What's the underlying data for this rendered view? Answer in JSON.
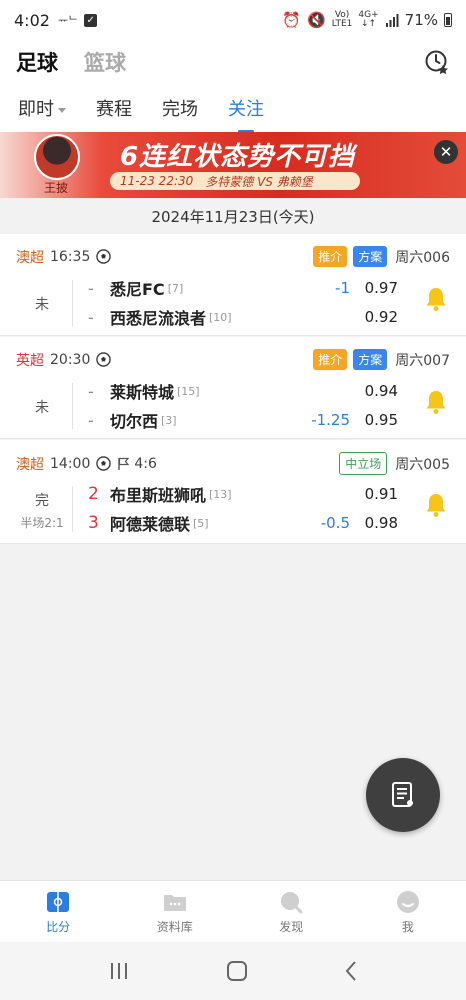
{
  "status_bar": {
    "time": "4:02",
    "left_mini": "ᅲᄂ",
    "net_top": "Vo)",
    "net_bottom": "LTE1",
    "sig_top": "4G+",
    "sig_bottom": "↓↑",
    "battery": "71%"
  },
  "top_nav": {
    "tab_football": "足球",
    "tab_basketball": "篮球"
  },
  "sub_tabs": [
    {
      "label": "即时"
    },
    {
      "label": "赛程"
    },
    {
      "label": "完场"
    },
    {
      "label": "关注"
    }
  ],
  "banner": {
    "person": "王披",
    "headline": "6连红状态势不可挡",
    "date": "11-23 22:30",
    "match": "多特蒙德 VS 弗赖堡"
  },
  "date_header": "2024年11月23日(今天)",
  "matches": [
    {
      "league": "澳超",
      "kickoff": "16:35",
      "badge1": "推介",
      "badge2": "方案",
      "match_no": "周六006",
      "status": "未",
      "home": {
        "score": "-",
        "name": "悉尼FC",
        "rank": "[7]",
        "handicap": "-1",
        "odds": "0.97"
      },
      "away": {
        "score": "-",
        "name": "西悉尼流浪者",
        "rank": "[10]",
        "handicap": "",
        "odds": "0.92"
      }
    },
    {
      "league": "英超",
      "kickoff": "20:30",
      "badge1": "推介",
      "badge2": "方案",
      "match_no": "周六007",
      "status": "未",
      "home": {
        "score": "-",
        "name": "莱斯特城",
        "rank": "[15]",
        "handicap": "",
        "odds": "0.94"
      },
      "away": {
        "score": "-",
        "name": "切尔西",
        "rank": "[3]",
        "handicap": "-1.25",
        "odds": "0.95"
      }
    },
    {
      "league": "澳超",
      "kickoff": "14:00",
      "corners": "4:6",
      "badge1": "中立场",
      "match_no": "周六005",
      "status": "完",
      "halftime": "半场2:1",
      "home": {
        "score": "2",
        "name": "布里斯班狮吼",
        "rank": "[13]",
        "handicap": "",
        "odds": "0.91"
      },
      "away": {
        "score": "3",
        "name": "阿德莱德联",
        "rank": "[5]",
        "handicap": "-0.5",
        "odds": "0.98"
      }
    }
  ],
  "bottom_nav": [
    {
      "label": "比分"
    },
    {
      "label": "资料库"
    },
    {
      "label": "发现"
    },
    {
      "label": "我"
    }
  ],
  "colors": {
    "accent": "#2b7de1",
    "league_orange": "#d9601a",
    "league_red": "#e2333a",
    "badge_orange": "#f6a623",
    "badge_blue": "#3a86ea",
    "bell": "#f5c518"
  }
}
